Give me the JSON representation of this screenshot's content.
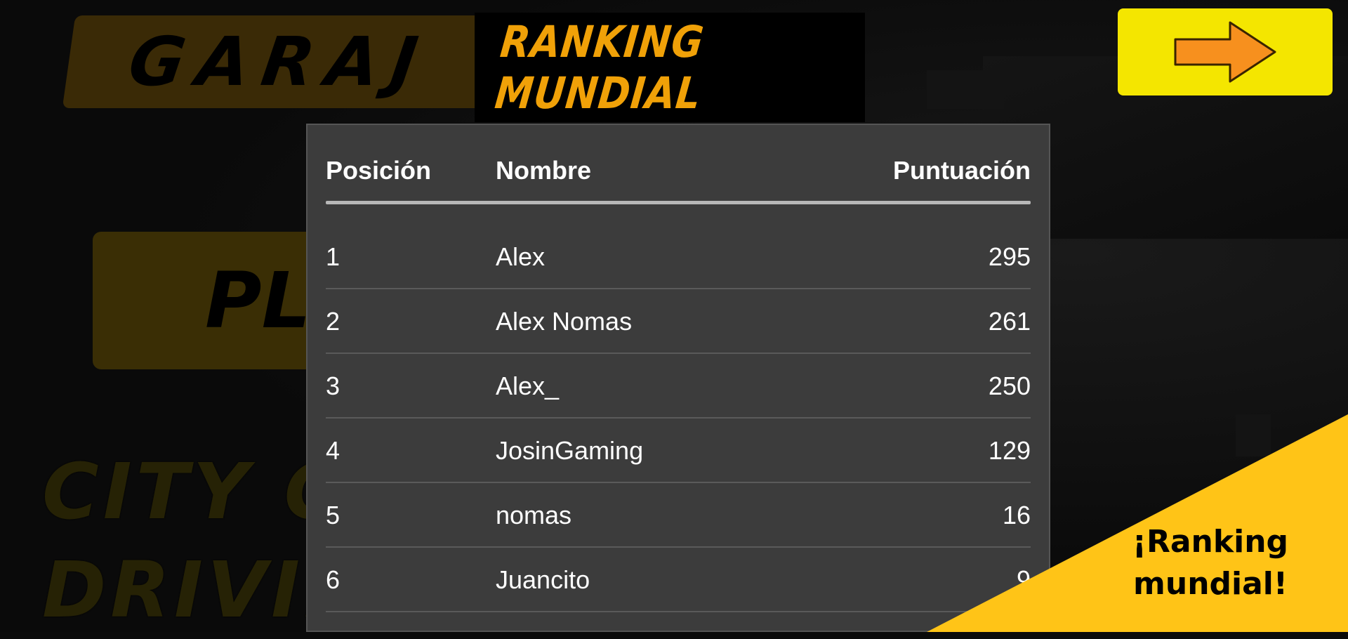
{
  "background": {
    "garage_label": "GARAJ",
    "play_label": "PL",
    "game_title_line1": "CITY C",
    "game_title_line2": "DRIVIN"
  },
  "header": {
    "title": "RANKING MUNDIAL"
  },
  "next_button": {
    "icon": "arrow-right-icon",
    "arrow_color": "#f7901e"
  },
  "leaderboard": {
    "columns": [
      "Posición",
      "Nombre",
      "Puntuación"
    ],
    "rows": [
      {
        "pos": "1",
        "name": "Alex",
        "score": "295"
      },
      {
        "pos": "2",
        "name": "Alex Nomas",
        "score": "261"
      },
      {
        "pos": "3",
        "name": "Alex_",
        "score": "250"
      },
      {
        "pos": "4",
        "name": "JosinGaming",
        "score": "129"
      },
      {
        "pos": "5",
        "name": "nomas",
        "score": "16"
      },
      {
        "pos": "6",
        "name": "Juancito",
        "score": "9"
      }
    ]
  },
  "promo": {
    "line1": "¡Ranking",
    "line2": "mundial!"
  },
  "colors": {
    "title_orange": "#f0a108",
    "button_yellow": "#f4e600",
    "promo_yellow": "#ffc417",
    "panel_bg": "#3c3c3c"
  }
}
